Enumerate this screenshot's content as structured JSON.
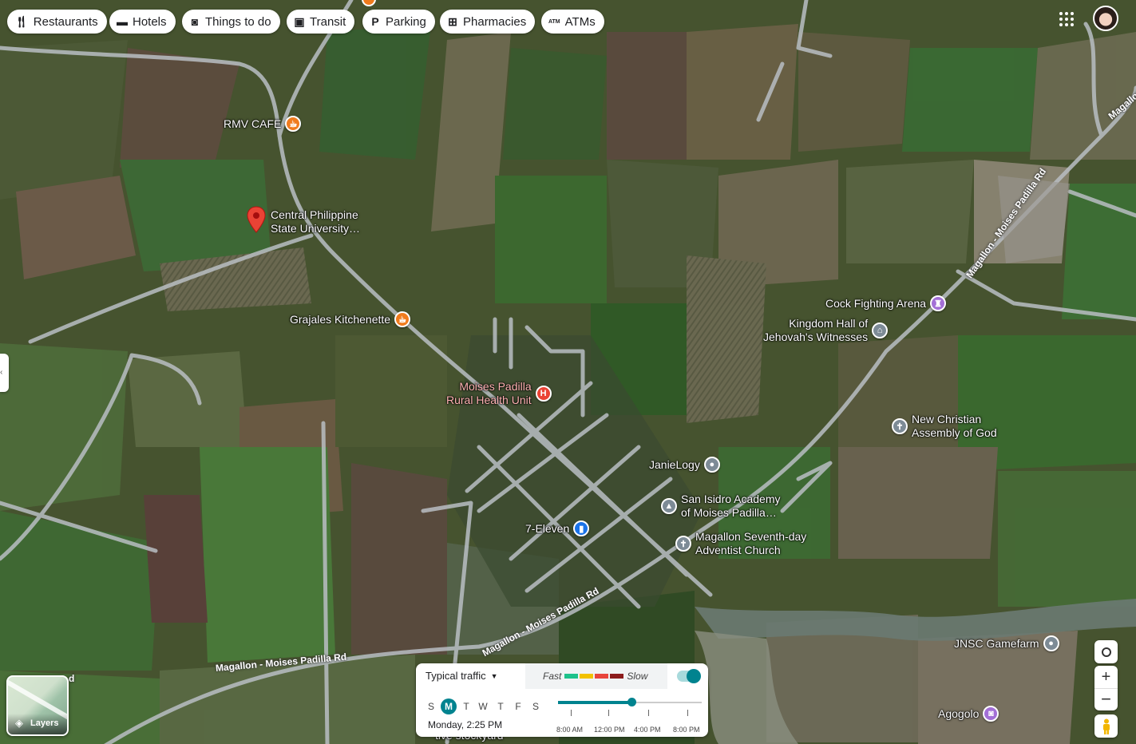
{
  "chips": [
    {
      "label": "Restaurants",
      "icon": "fork-knife-icon"
    },
    {
      "label": "Hotels",
      "icon": "bed-icon"
    },
    {
      "label": "Things to do",
      "icon": "camera-icon"
    },
    {
      "label": "Transit",
      "icon": "bus-icon"
    },
    {
      "label": "Parking",
      "icon": "parking-icon"
    },
    {
      "label": "Pharmacies",
      "icon": "pharmacy-icon"
    },
    {
      "label": "ATMs",
      "icon": "atm-icon"
    }
  ],
  "places": {
    "rmv_cafe": "RMV CAFE",
    "cpsu_line1": "Central Philippine",
    "cpsu_line2": "State University…",
    "grajales": "Grajales Kitchenette",
    "rhu_line1": "Moises Padilla",
    "rhu_line2": "Rural Health Unit",
    "cockfight": "Cock Fighting Arena",
    "kh_line1": "Kingdom Hall of",
    "kh_line2": "Jehovah's Witnesses",
    "nca_line1": "New Christian",
    "nca_line2": "Assembly of God",
    "janielogy": "JanieLogy",
    "sia_line1": "San Isidro Academy",
    "sia_line2": "of Moises Padilla…",
    "seven_eleven": "7-Eleven",
    "sda_line1": "Magallon Seventh-day",
    "sda_line2": "Adventist Church",
    "jnsc": "JNSC Gamefarm",
    "agogolo": "Agogolo",
    "bottom_partial": "tive stockyard"
  },
  "roads": {
    "r1": "Magallon - Moises Padilla Rd",
    "r2": "Magallon - Moises Padilla Rd",
    "r3": "Magallon - Moises Padilla Rd",
    "r4": "Magallon - Moises Padilla Rd",
    "r5_partial": "Magallo",
    "r6_partial": "d"
  },
  "layers_label": "Layers",
  "traffic": {
    "mode": "Typical traffic",
    "fast": "Fast",
    "slow": "Slow",
    "days": [
      "S",
      "M",
      "T",
      "W",
      "T",
      "F",
      "S"
    ],
    "selected_day": "M",
    "datetime": "Monday, 2:25 PM",
    "times": [
      "8:00 AM",
      "12:00 PM",
      "4:00 PM",
      "8:00 PM"
    ],
    "legend_colors": [
      "#1ec28b",
      "#f2c200",
      "#e8453c",
      "#8c1c1c"
    ],
    "toggle_on": true
  },
  "colors": {
    "accent": "#00838f",
    "pin_red": "#ea4335",
    "cafe_orange": "#f07b1d",
    "purple": "#a36fd6",
    "blue": "#1a73e8",
    "gray": "#7d8b96"
  }
}
